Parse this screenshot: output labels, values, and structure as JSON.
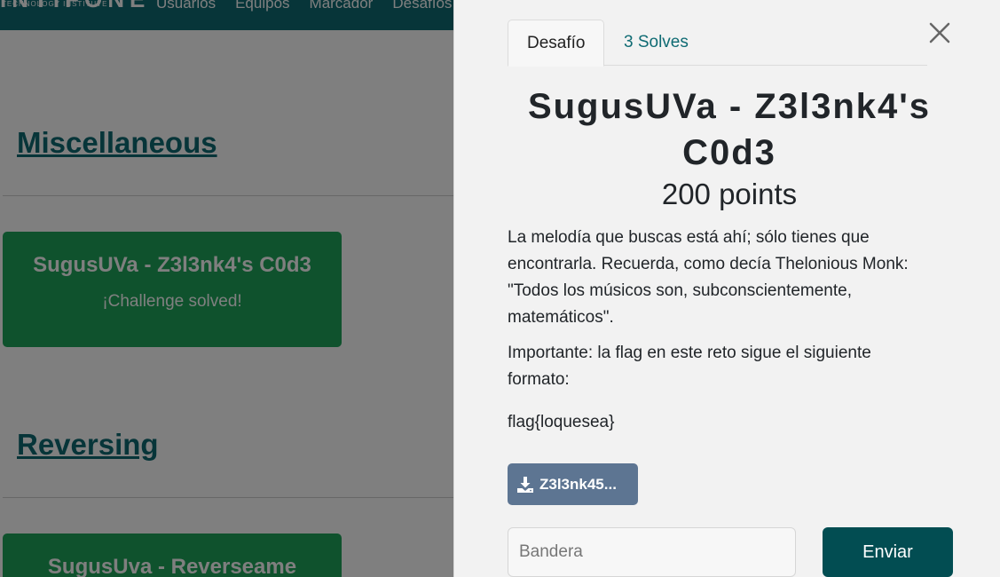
{
  "brand": {
    "name": "INTIFONE",
    "subtitle": "TECHNOLOGY INSTITUTE"
  },
  "nav": {
    "items": [
      "Usuarios",
      "Equipos",
      "Marcador",
      "Desafíos"
    ]
  },
  "categories": [
    {
      "name": "Miscellaneous",
      "cards": [
        {
          "title": "SugusUVa - Z3l3nk4's C0d3",
          "status": "¡Challenge solved!"
        }
      ]
    },
    {
      "name": "Reversing",
      "cards": [
        {
          "title": "SugusUva - Reverseame",
          "status": ""
        }
      ]
    }
  ],
  "modal": {
    "tabs": [
      "Desafío",
      "3 Solves"
    ],
    "active_tab": "Desafío",
    "close_icon": "close-icon",
    "title": "SugusUVa - Z3l3nk4's C0d3",
    "points": "200 points",
    "description": [
      "La melodía que buscas está ahí; sólo tienes que encontrarla. Recuerda, como decía Thelonious Monk: \"Todos los músicos son, subconscientemente, matemáticos\".",
      "Importante: la flag en este reto sigue el siguiente formato:",
      "flag{loquesea}"
    ],
    "file_button": {
      "label": "Z3l3nk45...",
      "icon": "download-icon"
    },
    "flag_input": {
      "placeholder": "Bandera",
      "value": ""
    },
    "submit_label": "Enviar"
  },
  "colors": {
    "navbar": "#0f6b73",
    "accent": "#0f6b73",
    "card_solved": "#1ea55a",
    "file_button": "#5d7592",
    "submit_button": "#024d52",
    "panel_bg": "#f2f2f2"
  }
}
